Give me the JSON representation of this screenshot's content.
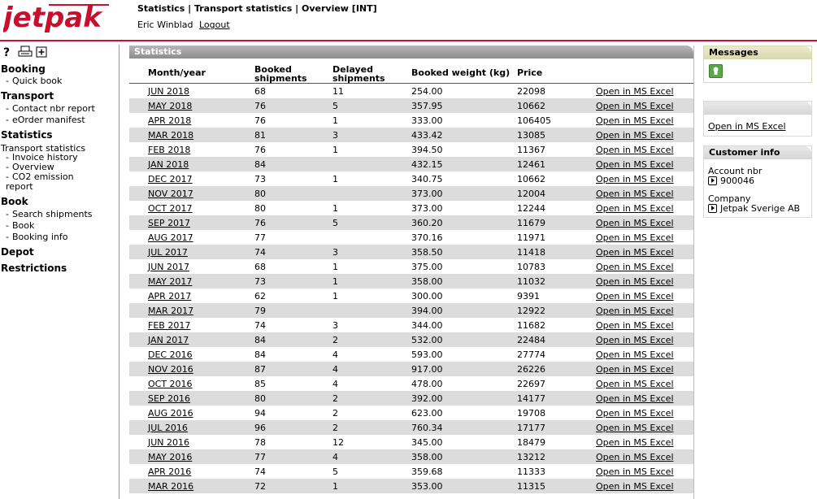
{
  "header": {
    "logo_text": "jetpak",
    "breadcrumb": "Statistics | Transport statistics | Overview [INT]",
    "user_name": "Eric Winblad",
    "logout_label": "Logout"
  },
  "toolbar": {
    "help_label": "?",
    "icons": [
      "print-icon",
      "add-window-icon"
    ]
  },
  "sidebar": {
    "sections": [
      {
        "title": "Booking",
        "items": [
          "Quick book"
        ]
      },
      {
        "title": "Transport",
        "items": [
          "Contact nbr report",
          "eOrder manifest"
        ]
      },
      {
        "title": "Statistics",
        "subtitle": "Transport statistics",
        "items": [
          "Invoice history",
          "Overview",
          "CO2 emission report"
        ]
      },
      {
        "title": "Book",
        "items": [
          "Search shipments",
          "Book",
          "Booking info"
        ]
      },
      {
        "title": "Depot",
        "items": []
      },
      {
        "title": "Restrictions",
        "items": []
      }
    ]
  },
  "statistics": {
    "panel_title": "Statistics",
    "columns": {
      "month": "Month/year",
      "booked": "Booked shipments",
      "delayed": "Delayed shipments",
      "weight": "Booked weight (kg)",
      "price": "Price"
    },
    "excel_label": "Open in MS Excel",
    "rows": [
      {
        "month": "JUN 2018",
        "booked": "68",
        "delayed": "11",
        "weight": "254.00",
        "price": "22098"
      },
      {
        "month": "MAY 2018",
        "booked": "76",
        "delayed": "5",
        "weight": "357.95",
        "price": "10662"
      },
      {
        "month": "APR 2018",
        "booked": "76",
        "delayed": "1",
        "weight": "333.00",
        "price": "106405"
      },
      {
        "month": "MAR 2018",
        "booked": "81",
        "delayed": "3",
        "weight": "433.42",
        "price": "13085"
      },
      {
        "month": "FEB 2018",
        "booked": "76",
        "delayed": "1",
        "weight": "394.50",
        "price": "11367"
      },
      {
        "month": "JAN 2018",
        "booked": "84",
        "delayed": "",
        "weight": "432.15",
        "price": "12461"
      },
      {
        "month": "DEC 2017",
        "booked": "73",
        "delayed": "1",
        "weight": "340.75",
        "price": "10662"
      },
      {
        "month": "NOV 2017",
        "booked": "80",
        "delayed": "",
        "weight": "373.00",
        "price": "12004"
      },
      {
        "month": "OCT 2017",
        "booked": "80",
        "delayed": "1",
        "weight": "373.00",
        "price": "12244"
      },
      {
        "month": "SEP 2017",
        "booked": "76",
        "delayed": "5",
        "weight": "360.20",
        "price": "11679"
      },
      {
        "month": "AUG 2017",
        "booked": "77",
        "delayed": "",
        "weight": "370.16",
        "price": "11971"
      },
      {
        "month": "JUL 2017",
        "booked": "74",
        "delayed": "3",
        "weight": "358.50",
        "price": "11418"
      },
      {
        "month": "JUN 2017",
        "booked": "68",
        "delayed": "1",
        "weight": "375.00",
        "price": "10783"
      },
      {
        "month": "MAY 2017",
        "booked": "73",
        "delayed": "1",
        "weight": "358.00",
        "price": "11032"
      },
      {
        "month": "APR 2017",
        "booked": "62",
        "delayed": "1",
        "weight": "300.00",
        "price": "9391"
      },
      {
        "month": "MAR 2017",
        "booked": "79",
        "delayed": "",
        "weight": "394.00",
        "price": "12922"
      },
      {
        "month": "FEB 2017",
        "booked": "74",
        "delayed": "3",
        "weight": "344.00",
        "price": "11682"
      },
      {
        "month": "JAN 2017",
        "booked": "84",
        "delayed": "2",
        "weight": "532.00",
        "price": "22484"
      },
      {
        "month": "DEC 2016",
        "booked": "84",
        "delayed": "4",
        "weight": "593.00",
        "price": "27774"
      },
      {
        "month": "NOV 2016",
        "booked": "87",
        "delayed": "4",
        "weight": "917.00",
        "price": "26226"
      },
      {
        "month": "OCT 2016",
        "booked": "85",
        "delayed": "4",
        "weight": "478.00",
        "price": "22697"
      },
      {
        "month": "SEP 2016",
        "booked": "80",
        "delayed": "2",
        "weight": "392.00",
        "price": "14177"
      },
      {
        "month": "AUG 2016",
        "booked": "94",
        "delayed": "2",
        "weight": "623.00",
        "price": "19708"
      },
      {
        "month": "JUL 2016",
        "booked": "96",
        "delayed": "2",
        "weight": "760.34",
        "price": "17177"
      },
      {
        "month": "JUN 2016",
        "booked": "78",
        "delayed": "12",
        "weight": "345.00",
        "price": "18479"
      },
      {
        "month": "MAY 2016",
        "booked": "77",
        "delayed": "4",
        "weight": "358.00",
        "price": "13212"
      },
      {
        "month": "APR 2016",
        "booked": "74",
        "delayed": "5",
        "weight": "359.68",
        "price": "11333"
      },
      {
        "month": "MAR 2016",
        "booked": "72",
        "delayed": "1",
        "weight": "353.00",
        "price": "11315"
      }
    ]
  },
  "messages": {
    "title": "Messages",
    "icon": "message-icon"
  },
  "excel_box": {
    "link_label": "Open in MS Excel"
  },
  "customer_info": {
    "title": "Customer info",
    "account_label": "Account nbr",
    "account_value": "900046",
    "company_label": "Company",
    "company_value": "Jetpak Sverige AB"
  },
  "colors": {
    "brand_red": "#c8102e",
    "panel_header": "#9f9f9f",
    "row_stripe": "#dcdcdc",
    "messages_header": "#e0e0bd"
  }
}
